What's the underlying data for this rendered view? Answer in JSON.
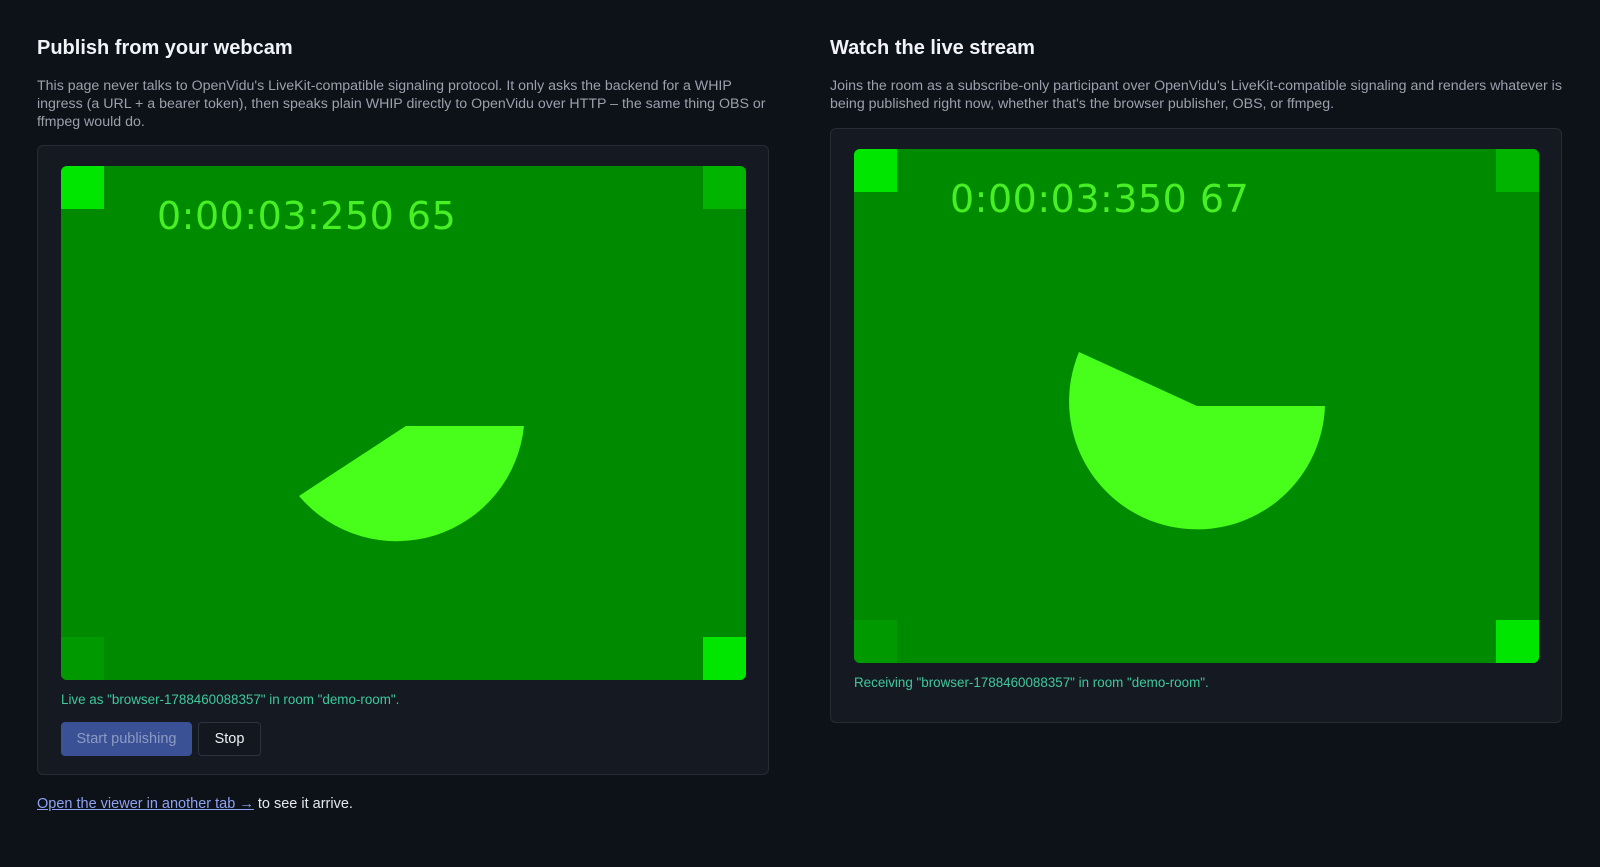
{
  "publish": {
    "title": "Publish from your webcam",
    "description": "This page never talks to OpenVidu's LiveKit-compatible signaling protocol. It only asks the backend for a WHIP ingress (a URL + a bearer token), then speaks plain WHIP directly to OpenVidu over HTTP – the same thing OBS or ffmpeg would do.",
    "timecode": "0:00:03:250 65",
    "status": "Live as \"browser-1788460088357\" in room \"demo-room\".",
    "start_label": "Start publishing",
    "stop_label": "Stop",
    "status_color": "#3fc99a"
  },
  "watch": {
    "title": "Watch the live stream",
    "description": "Joins the room as a subscribe-only participant over OpenVidu's LiveKit-compatible signaling and renders whatever is being published right now, whether that's the browser publisher, OBS, or ffmpeg.",
    "timecode": "0:00:03:350 67",
    "status": "Receiving \"browser-1788460088357\" in room \"demo-room\"."
  },
  "footer": {
    "link_text": "Open the viewer in another tab →",
    "suffix": " to see it arrive."
  },
  "colors": {
    "background": "#0d1118",
    "video_bg": "#008a00",
    "shape": "#47ff1a",
    "accent_button": "#3a5196",
    "link": "#8ea2f3"
  }
}
